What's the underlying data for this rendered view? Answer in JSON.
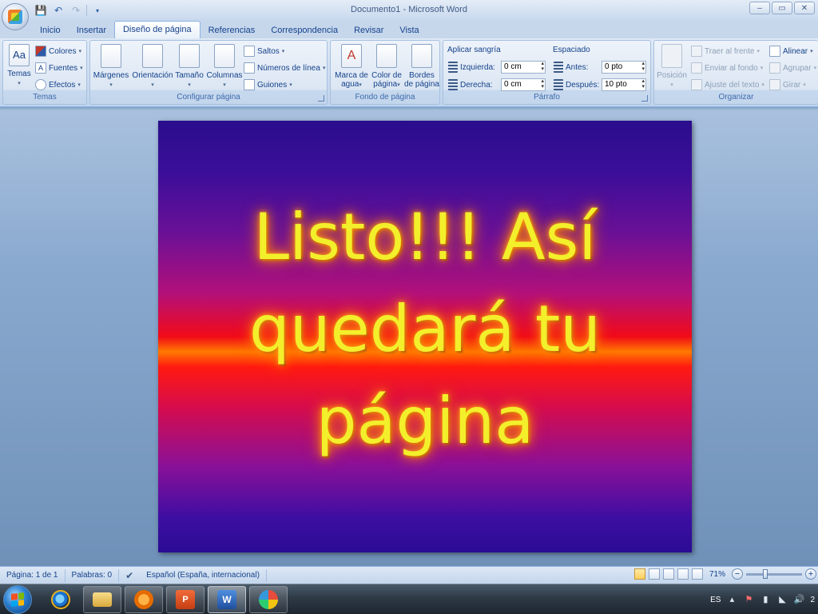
{
  "window": {
    "title": "Documento1 - Microsoft Word",
    "controls": [
      "–",
      "▭",
      "✕"
    ]
  },
  "qat": {
    "save_icon": "save-icon",
    "undo_icon": "undo-icon",
    "redo_icon": "redo-icon"
  },
  "tabs": [
    {
      "label": "Inicio",
      "active": false
    },
    {
      "label": "Insertar",
      "active": false
    },
    {
      "label": "Diseño de página",
      "active": true
    },
    {
      "label": "Referencias",
      "active": false
    },
    {
      "label": "Correspondencia",
      "active": false
    },
    {
      "label": "Revisar",
      "active": false
    },
    {
      "label": "Vista",
      "active": false
    }
  ],
  "ribbon": {
    "temas": {
      "group_label": "Temas",
      "big_label": "Temas",
      "colores": "Colores",
      "fuentes": "Fuentes",
      "efectos": "Efectos"
    },
    "configurar": {
      "group_label": "Configurar página",
      "margenes": "Márgenes",
      "orientacion": "Orientación",
      "tamano": "Tamaño",
      "columnas": "Columnas",
      "saltos": "Saltos",
      "numeros": "Números de línea",
      "guiones": "Guiones"
    },
    "fondo": {
      "group_label": "Fondo de página",
      "marca_1": "Marca de",
      "marca_2": "agua",
      "color_1": "Color de",
      "color_2": "página",
      "bordes_1": "Bordes",
      "bordes_2": "de página"
    },
    "parrafo": {
      "group_label": "Párrafo",
      "sangria_title": "Aplicar sangría",
      "izquierda_label": "Izquierda:",
      "izquierda_value": "0 cm",
      "derecha_label": "Derecha:",
      "derecha_value": "0 cm",
      "espaciado_title": "Espaciado",
      "antes_label": "Antes:",
      "antes_value": "0 pto",
      "despues_label": "Después:",
      "despues_value": "10 pto"
    },
    "organizar": {
      "group_label": "Organizar",
      "posicion": "Posición",
      "traer": "Traer al frente",
      "enviar": "Enviar al fondo",
      "ajuste": "Ajuste del texto",
      "alinear": "Alinear",
      "agrupar": "Agrupar",
      "girar": "Girar"
    }
  },
  "document": {
    "line1": "Listo!!! Así",
    "line2": "quedará tu",
    "line3": "página"
  },
  "status": {
    "pagina": "Página: 1 de 1",
    "palabras": "Palabras: 0",
    "idioma": "Español (España, internacional)",
    "zoom": "71%",
    "zoom_level_percent": 71
  },
  "taskbar": {
    "lang": "ES",
    "clock_partial": "2",
    "apps": [
      "internet-explorer",
      "file-explorer",
      "media-player",
      "powerpoint",
      "word",
      "paint"
    ]
  },
  "colors": {
    "accent": "#15428b",
    "text_yellow": "#f3ef2b"
  }
}
